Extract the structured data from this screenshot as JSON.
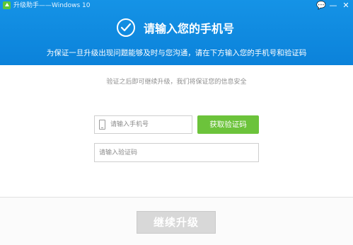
{
  "window": {
    "title": "升级助手——Windows 10",
    "buttons": {
      "message": "💬",
      "minimize": "—",
      "close": "✕"
    }
  },
  "header": {
    "icon": "check-circle-icon",
    "title": "请输入您的手机号",
    "subtitle": "为保证一旦升级出现问题能够及时与您沟通，请在下方输入您的手机号和验证码",
    "color": "#0e88de"
  },
  "form": {
    "hint": "验证之后即可继续升级，我们将保证您的信息安全",
    "phone": {
      "value": "",
      "placeholder": "请输入手机号",
      "icon": "phone-icon"
    },
    "get_code_label": "获取验证码",
    "get_code_color": "#6cc33b",
    "code": {
      "value": "",
      "placeholder": "请输入验证码"
    }
  },
  "footer": {
    "continue_label": "继续升级",
    "continue_state": "disabled"
  }
}
